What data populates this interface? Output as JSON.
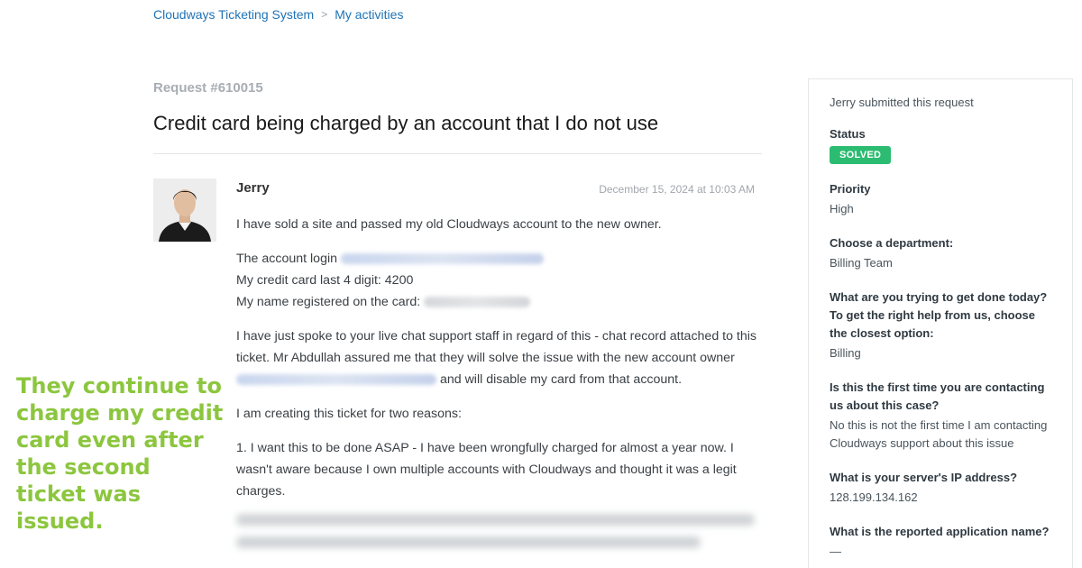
{
  "breadcrumb": {
    "home": "Cloudways Ticketing System",
    "separator": ">",
    "current": "My activities"
  },
  "request": {
    "number": "Request #610015",
    "title": "Credit card being charged by an account that I do not use"
  },
  "comment": {
    "author": "Jerry",
    "timestamp": "December 15, 2024 at 10:03 AM",
    "p1": "I have sold a site and passed my old Cloudways account to the new owner.",
    "login_label": "The account login",
    "card_digits": "My credit card last 4 digit: 4200",
    "name_label": "My name registered on the card:",
    "p3_line1": "I have just spoke to your live chat support staff in regard of this - chat record attached to this",
    "p3_line2": "ticket. Mr Abdullah assured me that they will solve the issue with the new account owner",
    "p3_line3_suffix": "and will disable my card from that account.",
    "p4": "I am creating this ticket for two reasons:",
    "p5": "1. I want this to be done ASAP - I have been wrongfully charged for almost a year now. I wasn't aware because I own multiple accounts with Cloudways and thought it was a legit charges."
  },
  "overlay": {
    "text": "They continue to charge my credit card even after the second ticket was issued."
  },
  "sidebar": {
    "submitted": "Jerry submitted this request",
    "status_label": "Status",
    "status_value": "SOLVED",
    "priority_label": "Priority",
    "priority_value": "High",
    "department_label": "Choose a department:",
    "department_value": "Billing Team",
    "goal_label": "What are you trying to get done today? To get the right help from us, choose the closest option:",
    "goal_value": "Billing",
    "first_time_label": "Is this the first time you are contacting us about this case?",
    "first_time_value": "No this is not the first time I am contacting Cloudways support about this issue",
    "ip_label": "What is your server's IP address?",
    "ip_value": "128.199.134.162",
    "app_label": "What is the reported application name?",
    "app_value": "—"
  },
  "colors": {
    "link": "#1f73b7",
    "status_solved": "#2cbc71",
    "overlay_text": "#8cc63f"
  }
}
